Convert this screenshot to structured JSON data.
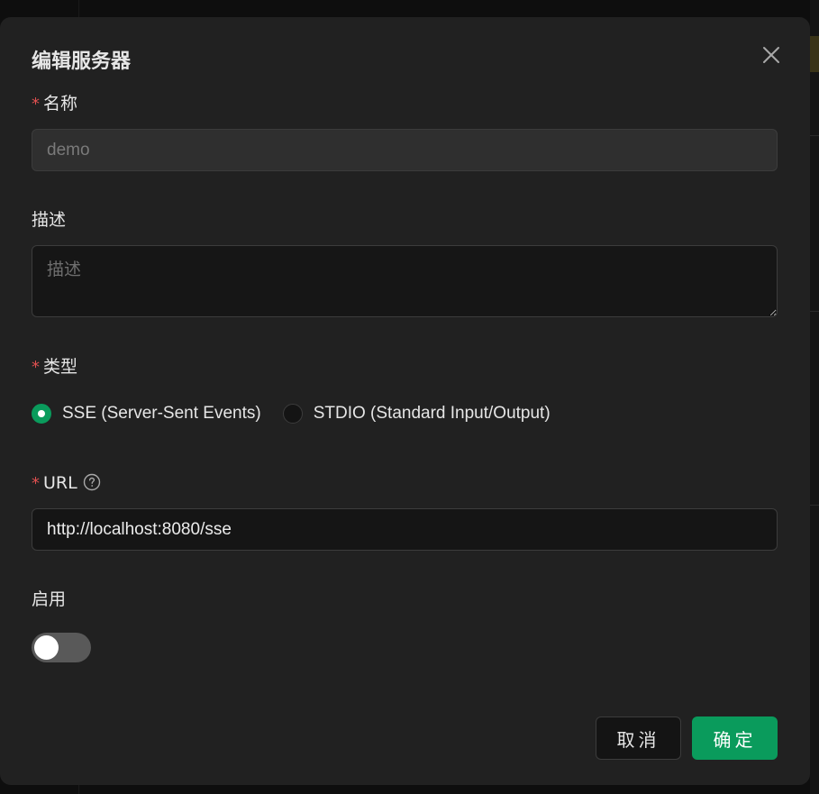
{
  "dialog": {
    "title": "编辑服务器",
    "close_icon": "close-icon"
  },
  "form": {
    "name": {
      "label": "名称",
      "required_mark": "*",
      "placeholder": "demo",
      "value": ""
    },
    "description": {
      "label": "描述",
      "placeholder": "描述",
      "value": ""
    },
    "type": {
      "label": "类型",
      "required_mark": "*",
      "options": [
        {
          "label": "SSE (Server-Sent Events)",
          "checked": true
        },
        {
          "label": "STDIO (Standard Input/Output)",
          "checked": false
        }
      ]
    },
    "url": {
      "label": "URL",
      "required_mark": "*",
      "help_icon": "question-circle-icon",
      "value": "http://localhost:8080/sse"
    },
    "enabled": {
      "label": "启用",
      "value": false
    }
  },
  "footer": {
    "cancel_label": "取消",
    "ok_label": "确定"
  },
  "colors": {
    "accent": "#0a9b5c",
    "required": "#e05050",
    "dialog_bg": "#212121"
  }
}
